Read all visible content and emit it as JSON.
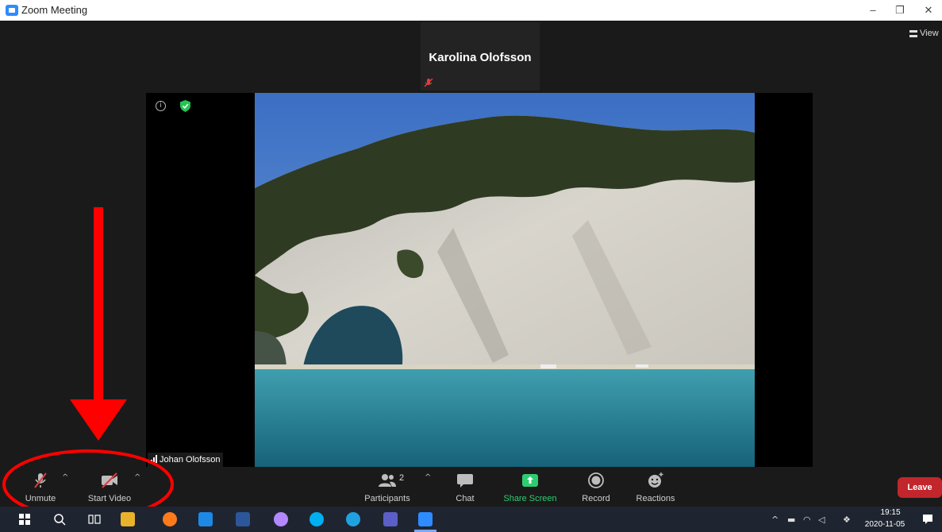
{
  "window": {
    "title": "Zoom Meeting",
    "controls": {
      "minimize": "–",
      "restore": "❐",
      "close": "✕"
    }
  },
  "view": {
    "label": "View"
  },
  "active_speaker": {
    "name": "Karolina Olofsson",
    "muted": true
  },
  "video": {
    "participant_name": "Johan Olofsson"
  },
  "toolbar": {
    "unmute_label": "Unmute",
    "start_video_label": "Start Video",
    "participants_label": "Participants",
    "participants_count": "2",
    "chat_label": "Chat",
    "share_screen_label": "Share Screen",
    "record_label": "Record",
    "reactions_label": "Reactions",
    "leave_label": "Leave",
    "caret": "^"
  },
  "colors": {
    "accent_zoom": "#2d8cff",
    "share_green": "#2ecc71",
    "leave_red": "#c1262c",
    "annotation_red": "#ff0000",
    "mute_red": "#e03c3c"
  },
  "taskbar": {
    "apps": [
      "windows-start",
      "search",
      "task-view",
      "file-explorer",
      "firefox",
      "mail",
      "word",
      "paint",
      "skype",
      "edge",
      "teams",
      "zoom"
    ],
    "time": "19:15",
    "date": "2020-11-05"
  }
}
